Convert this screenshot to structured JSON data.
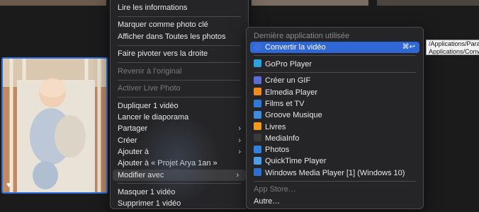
{
  "main_menu": {
    "items": [
      {
        "label": "Lire les informations",
        "enabled": true
      },
      {
        "sep": true
      },
      {
        "label": "Marquer comme photo clé",
        "enabled": true
      },
      {
        "label": "Afficher dans Toutes les photos",
        "enabled": true
      },
      {
        "sep": true
      },
      {
        "label": "Faire pivoter vers la droite",
        "enabled": true
      },
      {
        "sep": true
      },
      {
        "label": "Revenir à l’original",
        "enabled": false
      },
      {
        "sep": true
      },
      {
        "label": "Activer Live Photo",
        "enabled": false
      },
      {
        "sep": true
      },
      {
        "label": "Dupliquer 1 vidéo",
        "enabled": true
      },
      {
        "label": "Lancer le diaporama",
        "enabled": true
      },
      {
        "label": "Partager",
        "enabled": true,
        "submenu": true
      },
      {
        "label": "Créer",
        "enabled": true,
        "submenu": true
      },
      {
        "label": "Ajouter à",
        "enabled": true,
        "submenu": true
      },
      {
        "label": "Ajouter à « Projet Arya 1an »",
        "enabled": true
      },
      {
        "label": "Modifier avec",
        "enabled": true,
        "submenu": true,
        "active": true
      },
      {
        "sep": true
      },
      {
        "label": "Masquer 1 vidéo",
        "enabled": true
      },
      {
        "label": "Supprimer 1 vidéo",
        "enabled": true
      }
    ],
    "chevron": "›"
  },
  "sub_menu": {
    "header": "Dernière application utilisée",
    "recent": {
      "label": "Convertir la vidéo",
      "shortcut": "⌘↩",
      "icon": "convert-video-icon",
      "color": "#3a6fd8"
    },
    "groups": [
      [
        {
          "label": "GoPro Player",
          "icon": "gopro-icon",
          "color": "#2aa3e0"
        }
      ],
      [
        {
          "label": "Créer un GIF",
          "icon": "gif-icon",
          "color": "#5b6cd6"
        },
        {
          "label": "Elmedia Player",
          "icon": "elmedia-icon",
          "color": "#f08a24"
        },
        {
          "label": "Films et TV",
          "icon": "films-tv-icon",
          "color": "#2f7ad8"
        },
        {
          "label": "Groove Musique",
          "icon": "groove-icon",
          "color": "#3d8ee0"
        },
        {
          "label": "Livres",
          "icon": "books-icon",
          "color": "#f39a1f"
        },
        {
          "label": "MediaInfo",
          "icon": "mediainfo-icon",
          "color": "#3a3a3a"
        },
        {
          "label": "Photos",
          "icon": "photos-icon",
          "color": "#2e82e0"
        },
        {
          "label": "QuickTime Player",
          "icon": "quicktime-icon",
          "color": "#4aa0e8"
        },
        {
          "label": "Windows Media Player [1] (Windows 10)",
          "icon": "wmp-icon",
          "color": "#2d6fd0"
        }
      ]
    ],
    "app_store": "App Store…",
    "other": "Autre…"
  },
  "tooltip": {
    "line1": "/Applications/Paral",
    "line2": "Applications/Conve"
  },
  "photo": {
    "heart": "♥"
  }
}
